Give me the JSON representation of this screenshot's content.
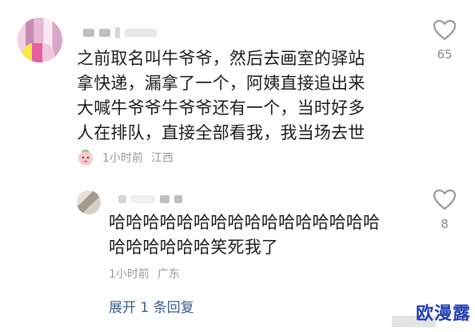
{
  "comment": {
    "lines": [
      "之前取名叫牛爷爷，然后去画室的驿站",
      "拿快递，漏拿了一个，阿姨直接追出来",
      "大喊牛爷爷牛爷爷还有一个，当时好多",
      "人在排队，直接全部看我，我当场去世"
    ],
    "time": "1小时前",
    "location": "江西",
    "likes": "65",
    "badge_icon": "pink-face-badge-icon"
  },
  "reply": {
    "lines": [
      "哈哈哈哈哈哈哈哈哈哈哈哈哈哈哈哈",
      "哈哈哈哈哈哈笑死我了"
    ],
    "time": "1小时前",
    "location": "广东",
    "likes": "8"
  },
  "expand_replies": "展开 1 条回复",
  "watermark": "欧漫露",
  "colors": {
    "link": "#3b5e8f",
    "meta": "#9a9a9a",
    "watermark": "#1f3fb4"
  }
}
